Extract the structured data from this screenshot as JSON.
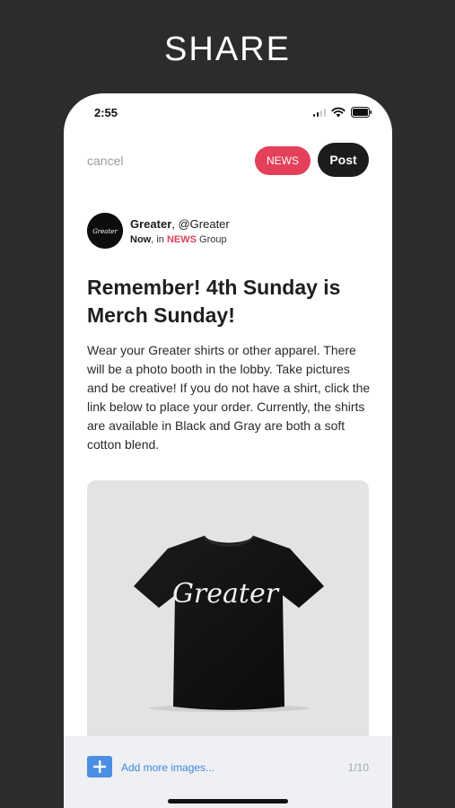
{
  "header": {
    "title": "SHARE"
  },
  "status_bar": {
    "time": "2:55",
    "icons": [
      "cellular-signal-icon",
      "wifi-icon",
      "battery-icon"
    ]
  },
  "composer": {
    "cancel_label": "cancel",
    "group_tag_label": "NEWS",
    "post_label": "Post"
  },
  "author": {
    "name": "Greater",
    "handle": ", @Greater",
    "time": "Now",
    "in_text": ", in ",
    "group": "NEWS",
    "group_suffix": " Group",
    "avatar_text": "Greater"
  },
  "post": {
    "title": "Remember! 4th Sunday is Merch Sunday!",
    "body": "Wear your Greater shirts or other apparel. There will be a photo booth in the lobby. Take pictures and be creative! If you do not have a shirt, click the link below to place your order. Currently, the shirts are available in Black and Gray are both a soft cotton blend.",
    "image_text": "Greater"
  },
  "images": {
    "add_label": "Add more images...",
    "counter": "1/10"
  },
  "colors": {
    "background": "#2b2c2e",
    "accent": "#e4405a",
    "post_button": "#1c1c1c",
    "link": "#3f86dc"
  }
}
